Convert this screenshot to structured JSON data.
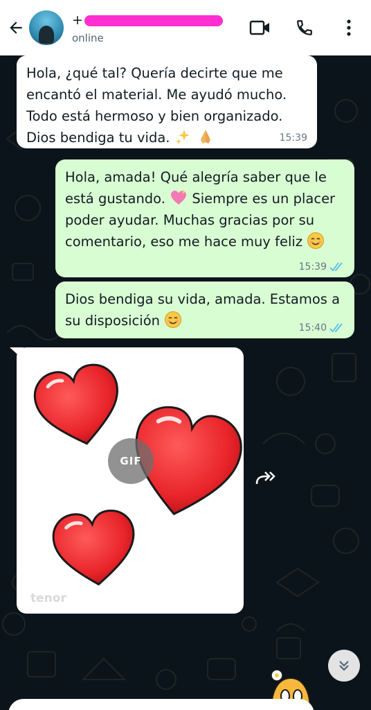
{
  "header": {
    "back_icon": "arrow-left-icon",
    "contact_name": "+",
    "status": "online",
    "actions": [
      "video-call-icon",
      "phone-icon",
      "more-vert-icon"
    ]
  },
  "messages": [
    {
      "direction": "incoming",
      "lines": [
        "Hola, ¿qué tal? Quería decirte que me",
        "encantó el material. Me ayudó mucho.",
        "Todo está hermoso y bien organizado.",
        "Dios bendiga tu vida."
      ],
      "emojis": [
        "sparkles",
        "folded-hands"
      ],
      "time": "15:39"
    },
    {
      "direction": "outgoing",
      "lines": [
        "Hola, amada! Qué alegría saber que le",
        "está gustando.",
        "Siempre es un placer",
        "poder ayudar. Muchas gracias por su",
        "comentario, eso me hace muy feliz"
      ],
      "emojis": [
        "sparkling-heart",
        "smiling-face"
      ],
      "time": "15:39",
      "read": true
    },
    {
      "direction": "outgoing",
      "lines": [
        "Dios bendiga su vida, amada. Estamos a",
        "su disposición"
      ],
      "emojis": [
        "smiling-face"
      ],
      "time": "15:40",
      "read": true
    }
  ],
  "gif": {
    "badge": "GIF",
    "watermark": "tenor"
  },
  "colors": {
    "incoming_bubble": "#ffffff",
    "outgoing_bubble": "#d9fdd3",
    "chat_background": "#0b141a",
    "read_ticks": "#53bdeb",
    "heart": "#e8242a"
  }
}
